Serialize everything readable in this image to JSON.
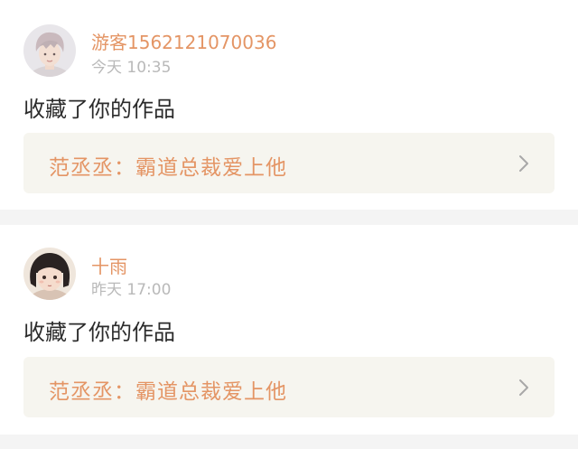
{
  "notifications": [
    {
      "username": "游客1562121070036",
      "time": "今天 10:35",
      "action": "收藏了你的作品",
      "work_title": "范丞丞：霸道总裁爱上他",
      "avatar_icon": "user-avatar-boy"
    },
    {
      "username": "十雨",
      "time": "昨天 17:00",
      "action": "收藏了你的作品",
      "work_title": "范丞丞：霸道总裁爱上他",
      "avatar_icon": "user-avatar-girl"
    }
  ],
  "colors": {
    "accent": "#e49565",
    "time": "#b9b9b9",
    "text": "#2b2b2b",
    "link_bg": "#f6f5ef",
    "page_bg": "#f4f4f4"
  }
}
